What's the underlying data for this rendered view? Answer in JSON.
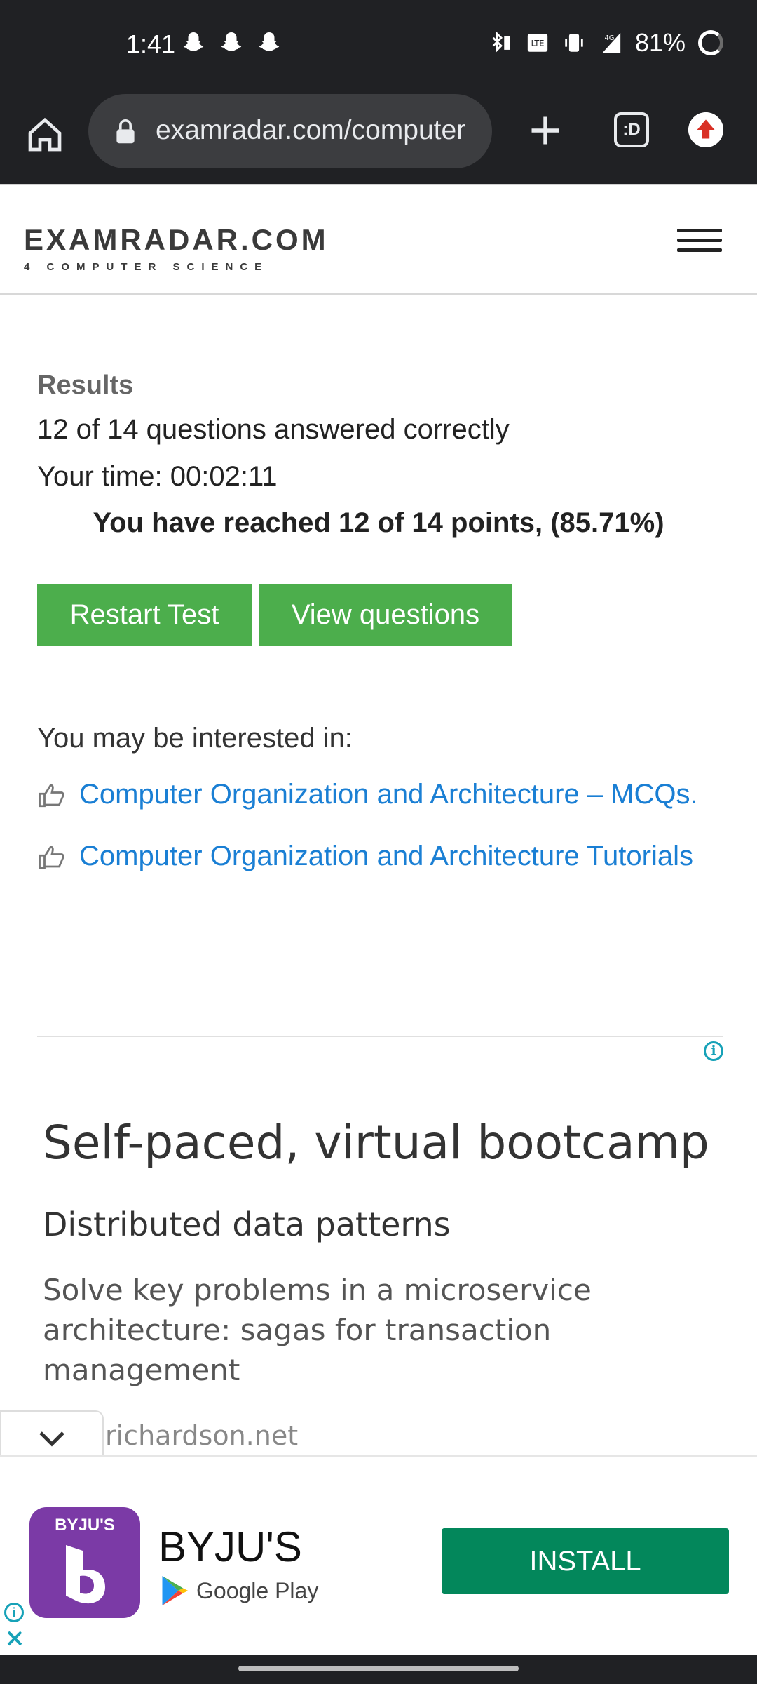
{
  "status_bar": {
    "time": "1:41",
    "battery": "81%"
  },
  "browser": {
    "url": "examradar.com/computer",
    "tab_count": ":D"
  },
  "site": {
    "logo": "EXAMRADAR.COM",
    "tagline": "4 COMPUTER SCIENCE"
  },
  "results": {
    "label": "Results",
    "answered": "12 of 14 questions answered correctly",
    "time": "Your time: 00:02:11",
    "points": "You have reached 12 of 14 points, (85.71%)"
  },
  "buttons": {
    "restart": "Restart Test",
    "view": "View questions"
  },
  "related": {
    "heading": "You may be interested in:",
    "links": [
      "Computer Organization and Architecture – MCQs.",
      "Computer Organization and Architecture Tutorials"
    ]
  },
  "ad": {
    "title": "Self-paced, virtual bootcamp",
    "subtitle": "Distributed data patterns",
    "description": "Solve key problems in a microservice architecture: sagas for transaction management",
    "domain": "richardson.net"
  },
  "banner": {
    "logo_text": "BYJU'S",
    "name": "BYJU'S",
    "store": "Google Play",
    "install": "INSTALL"
  },
  "colors": {
    "primary_button": "#4cae4c",
    "link": "#1a7fd4",
    "install": "#03875b",
    "byju": "#7b3aa6"
  }
}
